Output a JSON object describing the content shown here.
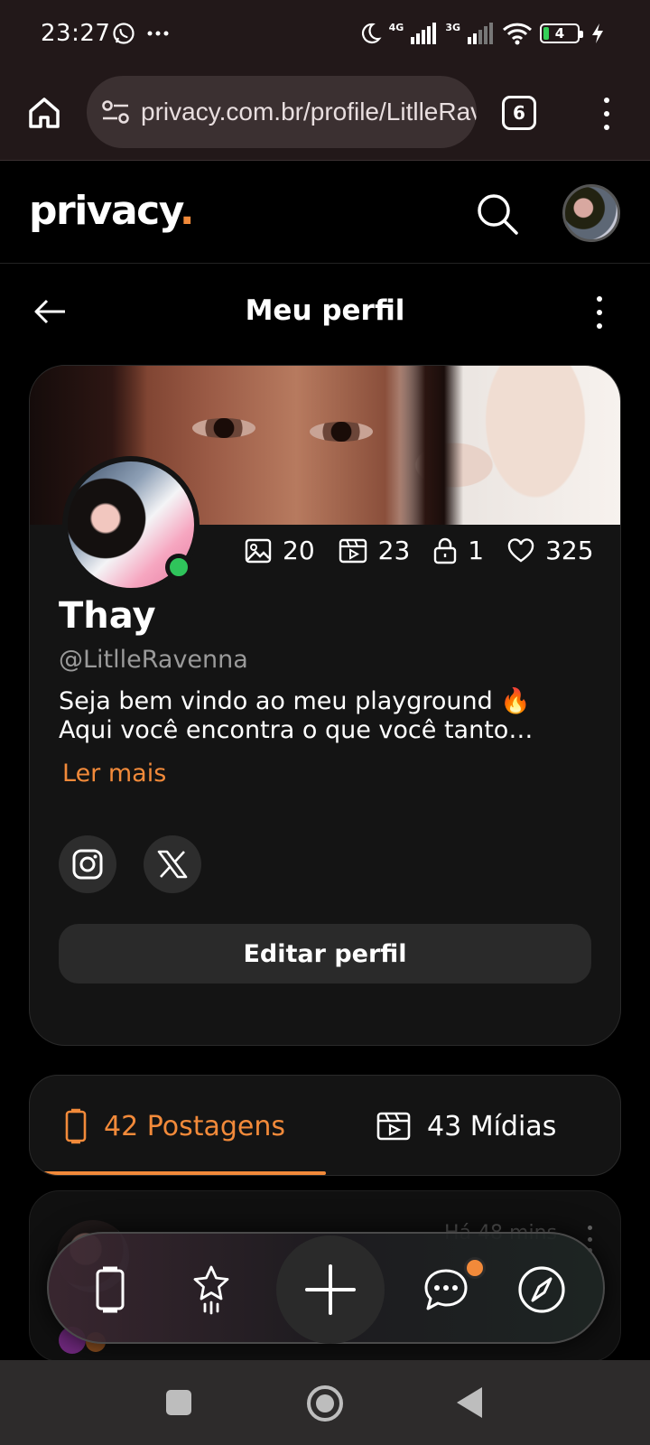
{
  "status_bar": {
    "time": "23:27",
    "network_1": "4G",
    "network_2": "3G",
    "battery_level": "4",
    "battery_percent": 4,
    "icons": [
      "whatsapp-icon",
      "more-notifications-icon",
      "do-not-disturb-moon-icon",
      "signal-icon",
      "wifi-icon",
      "battery-icon",
      "charging-bolt-icon"
    ]
  },
  "browser": {
    "url": "privacy.com.br/profile/LitlleRavenna",
    "tab_count": "6"
  },
  "app": {
    "logo": "privacy",
    "accent_color": "#f28a3a"
  },
  "page": {
    "title": "Meu perfil"
  },
  "profile": {
    "name": "Thay",
    "handle": "@LitlleRavenna",
    "bio": "Seja bem vindo ao meu playground 🔥 Aqui você encontra o que você tanto…",
    "read_more": "Ler mais",
    "online": true,
    "stats": {
      "photos": "20",
      "videos": "23",
      "locked": "1",
      "likes": "325"
    },
    "edit_button": "Editar perfil"
  },
  "tabs": {
    "posts_label": "42 Postagens",
    "media_label": "43 Mídias",
    "active": "posts"
  },
  "post_preview": {
    "time": "Há 48 mins"
  }
}
